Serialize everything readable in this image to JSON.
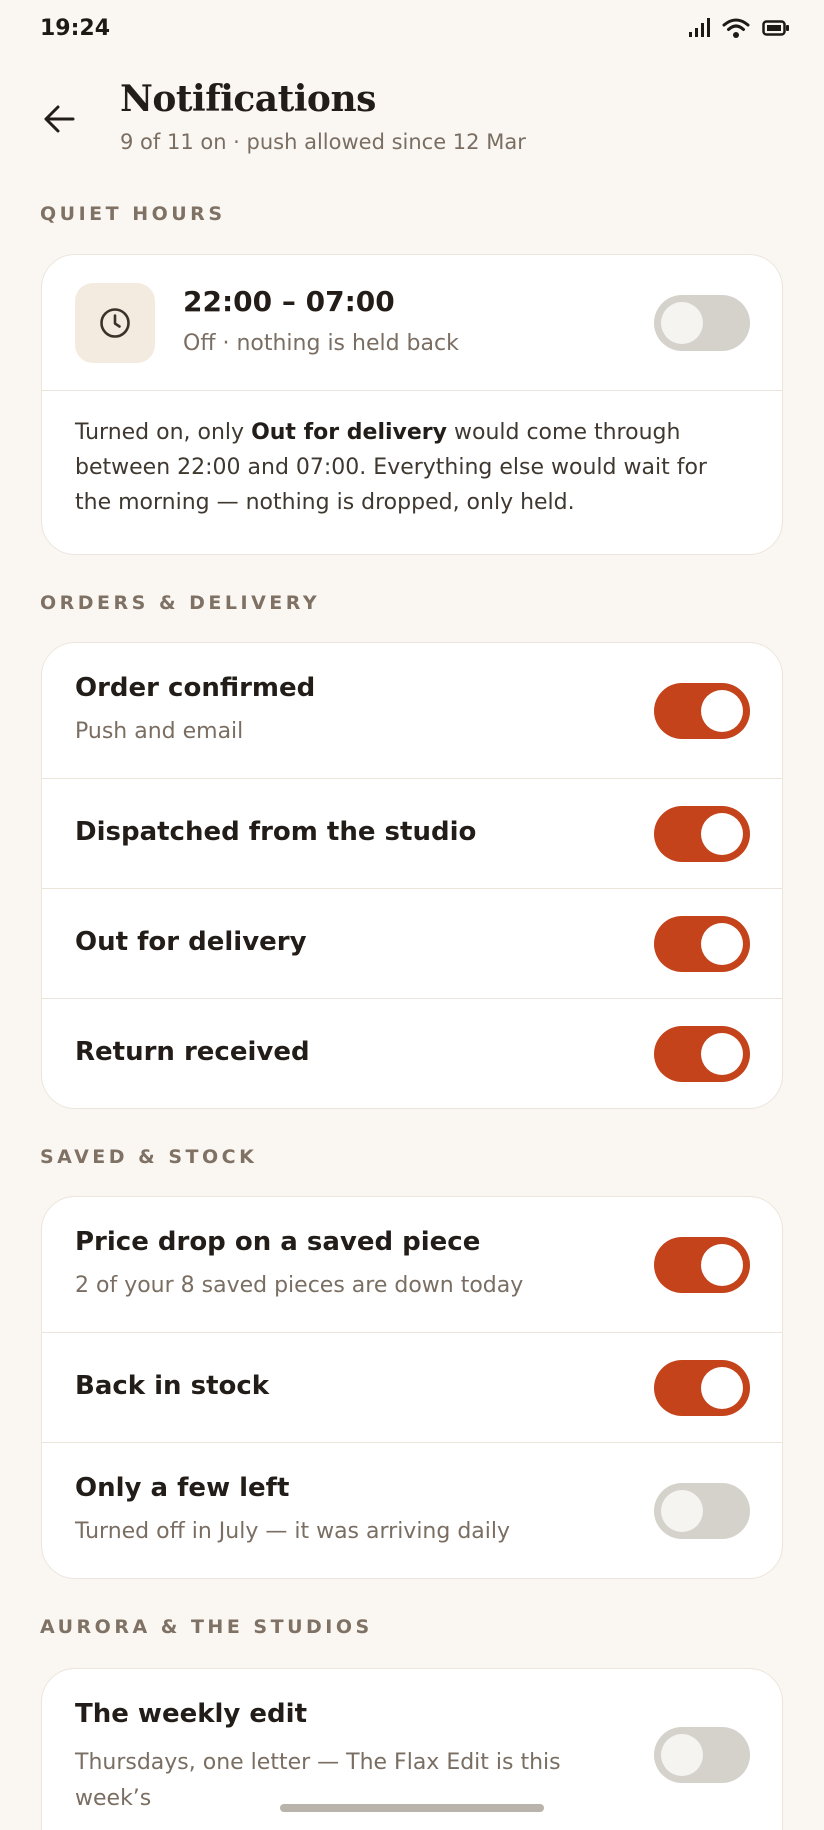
{
  "status_bar": {
    "time": "19:24"
  },
  "header": {
    "title": "Notifications",
    "subtitle": "9 of 11 on · push allowed since 12 Mar"
  },
  "sections": {
    "quiet": {
      "label": "QUIET HOURS",
      "time_range": "22:00 – 07:00",
      "state_text": "Off · nothing is held back",
      "enabled": false,
      "note_prefix": "Turned on, only ",
      "note_bold": "Out for delivery",
      "note_suffix": " would come through between 22:00 and 07:00. Everything else would wait for the morning — nothing is dropped, only held."
    },
    "orders": {
      "label": "ORDERS & DELIVERY",
      "items": [
        {
          "title": "Order confirmed",
          "subtitle": "Push and email",
          "enabled": true
        },
        {
          "title": "Dispatched from the studio",
          "enabled": true
        },
        {
          "title": "Out for delivery",
          "enabled": true
        },
        {
          "title": "Return received",
          "enabled": true
        }
      ]
    },
    "saved": {
      "label": "SAVED & STOCK",
      "items": [
        {
          "title": "Price drop on a saved piece",
          "subtitle": "2 of your 8 saved pieces are down today",
          "enabled": true
        },
        {
          "title": "Back in stock",
          "enabled": true
        },
        {
          "title": "Only a few left",
          "subtitle": "Turned off in July — it was arriving daily",
          "enabled": false
        }
      ]
    },
    "aurora": {
      "label": "AURORA & THE STUDIOS",
      "items": [
        {
          "title": "The weekly edit",
          "subtitle": "Thursdays, one letter — The Flax Edit is this week’s",
          "enabled": false
        }
      ]
    }
  },
  "colors": {
    "accent": "#c4431a",
    "toggle_off": "#d5d1cb",
    "background": "#faf7f3"
  }
}
